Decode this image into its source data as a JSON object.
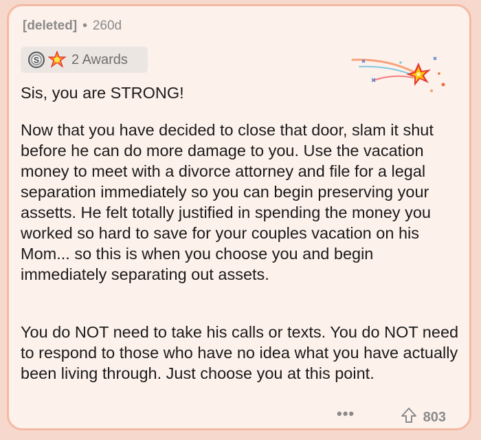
{
  "comment": {
    "author": "[deleted]",
    "separator": "•",
    "age": "260d",
    "awards_label": "2 Awards",
    "paragraphs": [
      "Sis, you are STRONG!",
      "Now that you have decided to close that door, slam it shut before he can do more damage to you. Use the vacation money to meet with a divorce attorney and file for a legal separation immediately so you can begin preserving your assetts. He felt totally justified in spending the money you worked so hard to save for your couples vacation on his Mom... so this is when you choose you and begin immediately separating out assets.",
      "You do NOT need to take his calls or texts. You do NOT need to respond to those who have no idea what you have actually been living through. Just choose you at this point."
    ],
    "more_label": "•••",
    "score": "803"
  },
  "colors": {
    "background": "#f6d9cc",
    "card": "#fdf1eb",
    "border": "#f4b9a3",
    "meta": "#8a8a8a"
  },
  "icons": {
    "award_1": "silver-coin-icon",
    "award_2": "starburst-award-icon",
    "decoration": "shooting-star-burst-icon",
    "vote": "upvote-arrow-icon"
  }
}
